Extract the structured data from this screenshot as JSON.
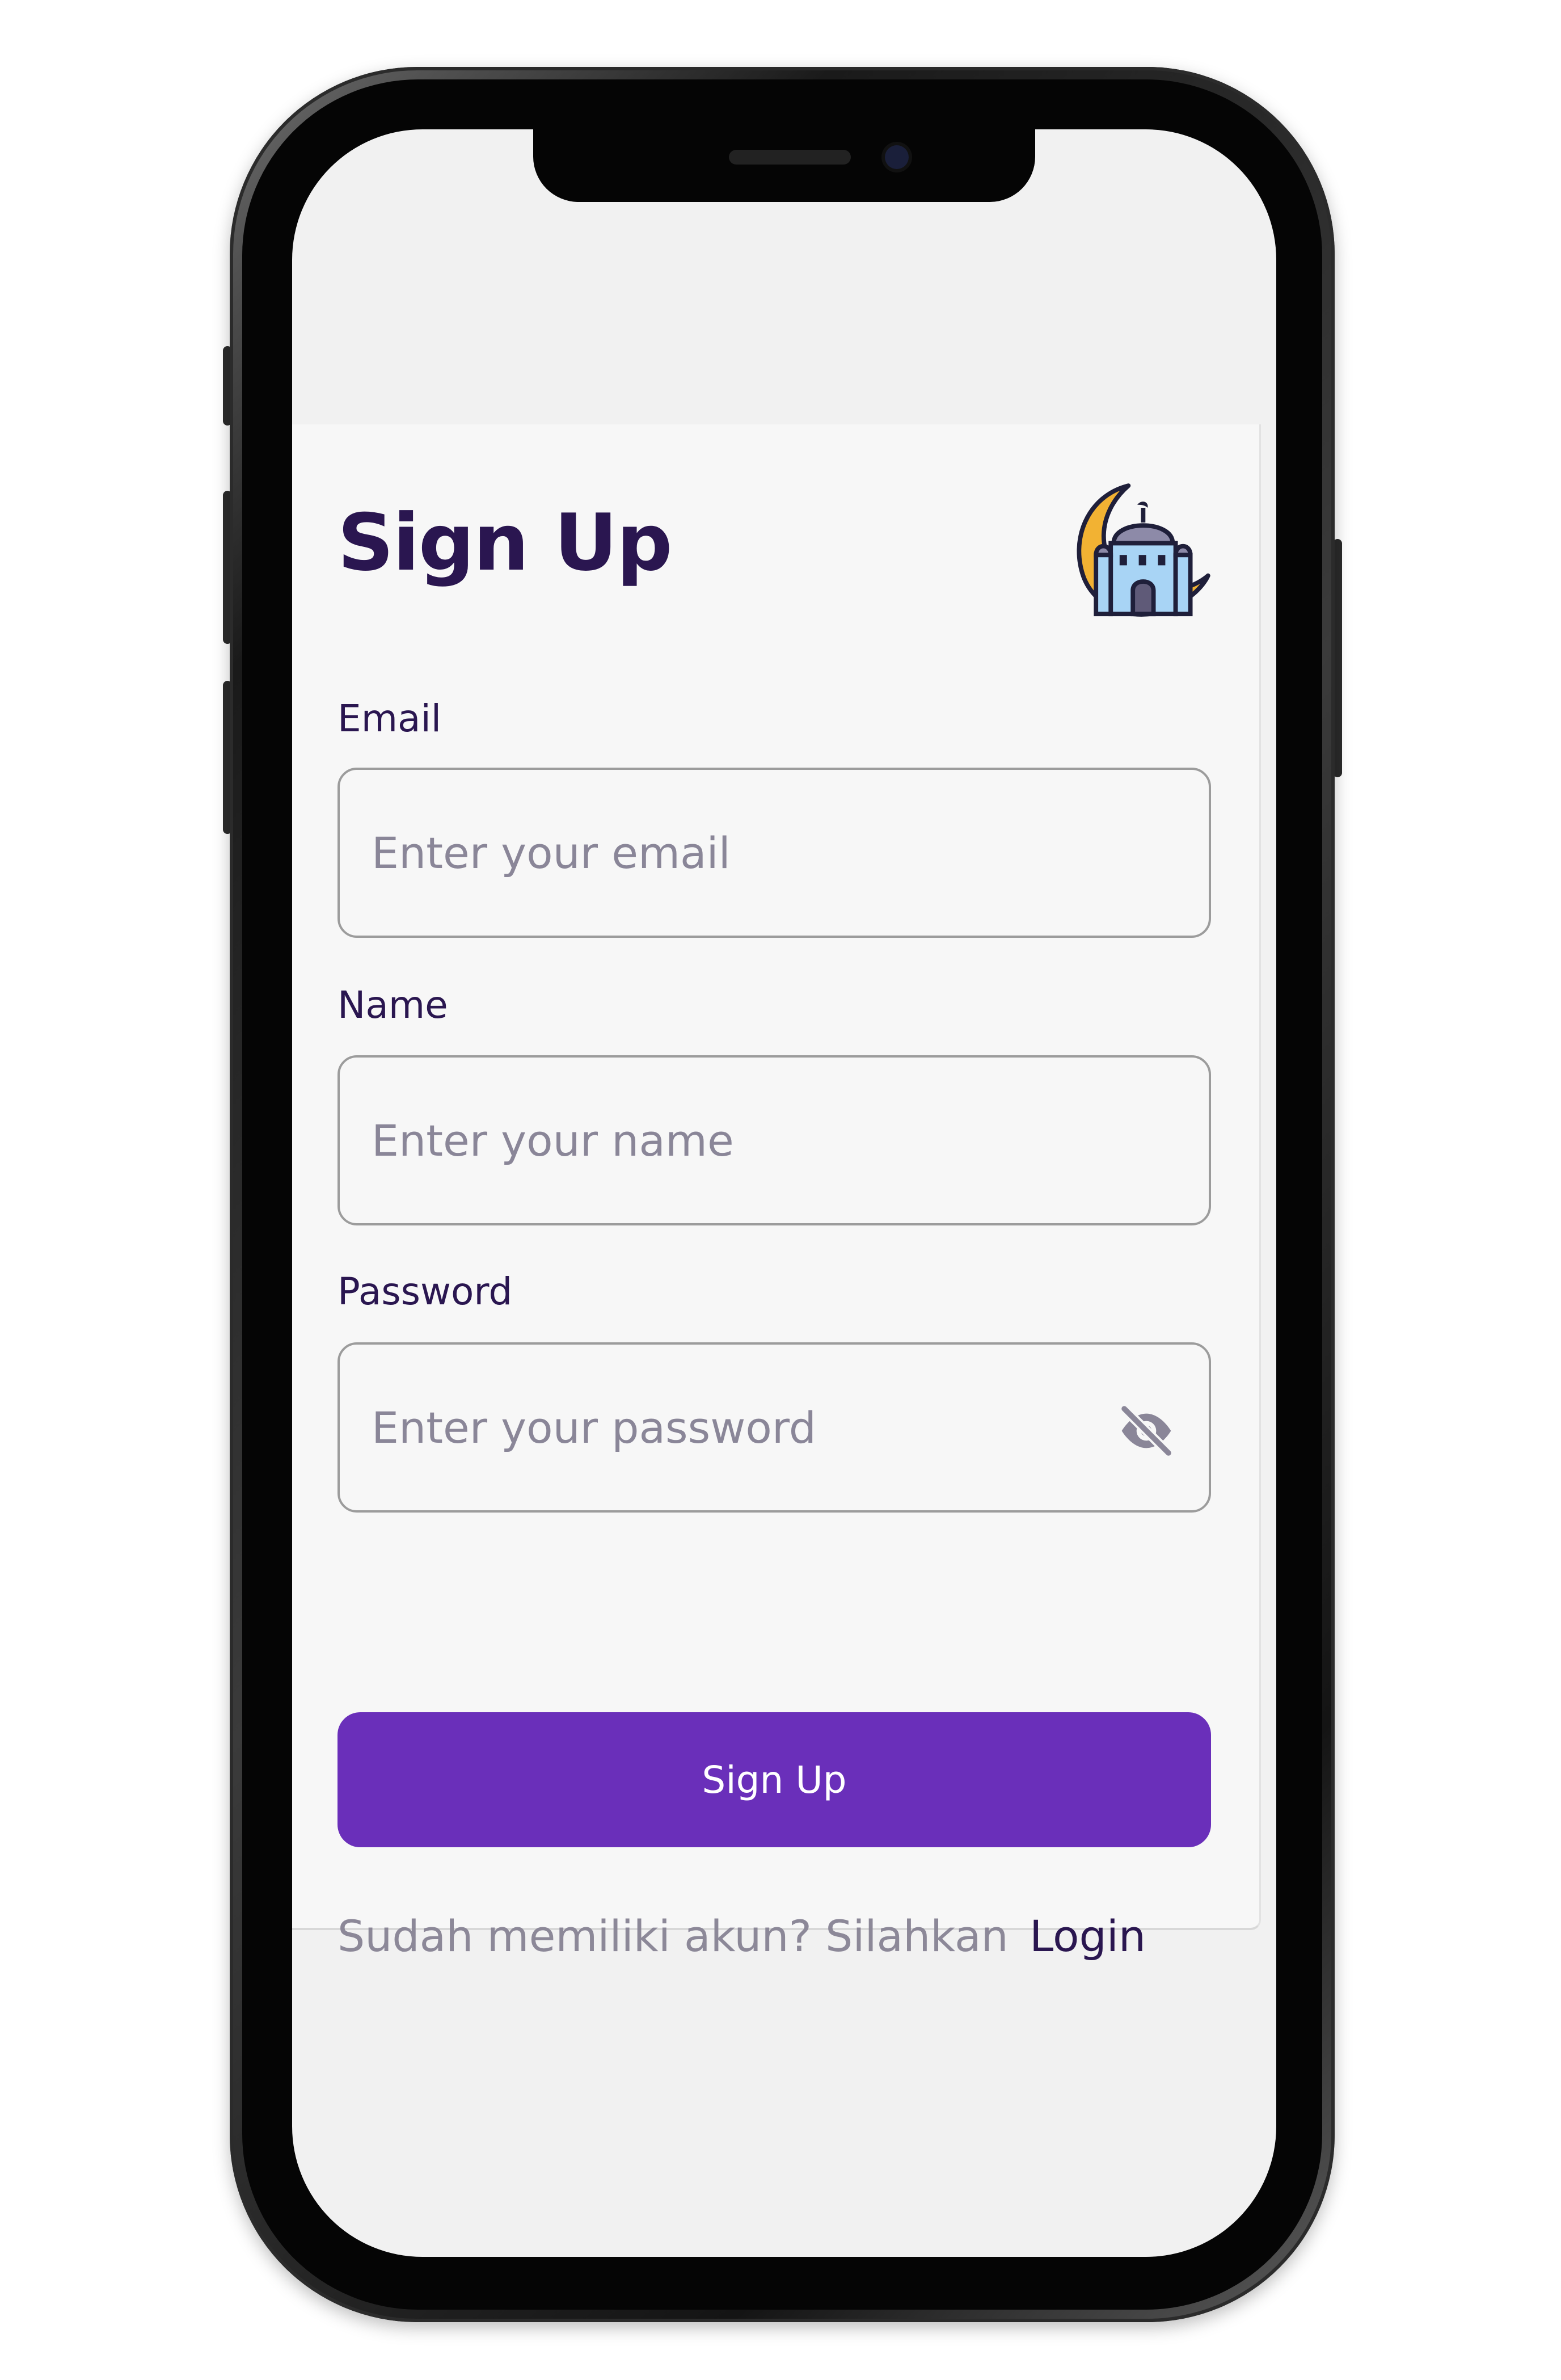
{
  "header": {
    "title": "Sign Up",
    "logo_icon": "mosque-crescent-icon"
  },
  "form": {
    "email": {
      "label": "Email",
      "placeholder": "Enter your email",
      "value": ""
    },
    "name": {
      "label": "Name",
      "placeholder": "Enter your name",
      "value": ""
    },
    "password": {
      "label": "Password",
      "placeholder": "Enter your password",
      "value": "",
      "visibility_icon": "eye-off-icon"
    },
    "submit_label": "Sign Up"
  },
  "footer": {
    "prompt": "Sudah memiliki akun? Silahkan",
    "login_label": "Login"
  },
  "colors": {
    "primary": "#6a2fba",
    "heading": "#2a1650",
    "placeholder": "#8a8698",
    "border": "#9c9c9c",
    "background": "#f7f7f7"
  }
}
